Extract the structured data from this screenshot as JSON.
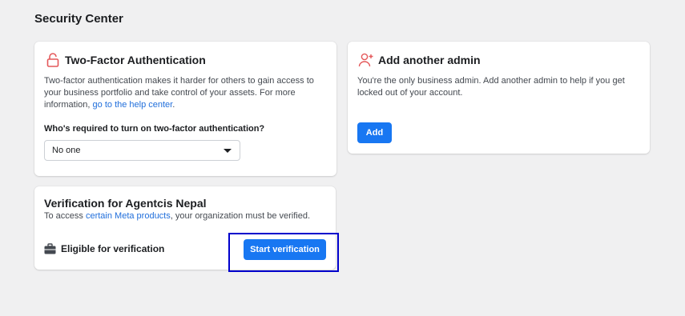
{
  "page": {
    "title": "Security Center"
  },
  "two_factor": {
    "icon": "lock-open-icon",
    "title": "Two-Factor Authentication",
    "description": "Two-factor authentication makes it harder for others to gain access to your business portfolio and take control of your assets. For more information,",
    "link_text": "go to the help center",
    "description_end": ".",
    "question": "Who's required to turn on two-factor authentication?",
    "select_value": "No one"
  },
  "add_admin": {
    "icon": "add-person-icon",
    "title": "Add another admin",
    "description": "You're the only business admin. Add another admin to help if you get locked out of your account.",
    "button_label": "Add"
  },
  "verification": {
    "title": "Verification for Agentcis Nepal",
    "sub_prefix": "To access ",
    "sub_link": "certain Meta products",
    "sub_suffix": ", your organization must be verified.",
    "eligible_icon": "briefcase-icon",
    "eligible_label": "Eligible for verification",
    "button_label": "Start verification"
  },
  "colors": {
    "accent": "#1877f2",
    "link": "#216fdb",
    "icon_red": "#e4585a",
    "highlight_border": "#0000cc"
  }
}
